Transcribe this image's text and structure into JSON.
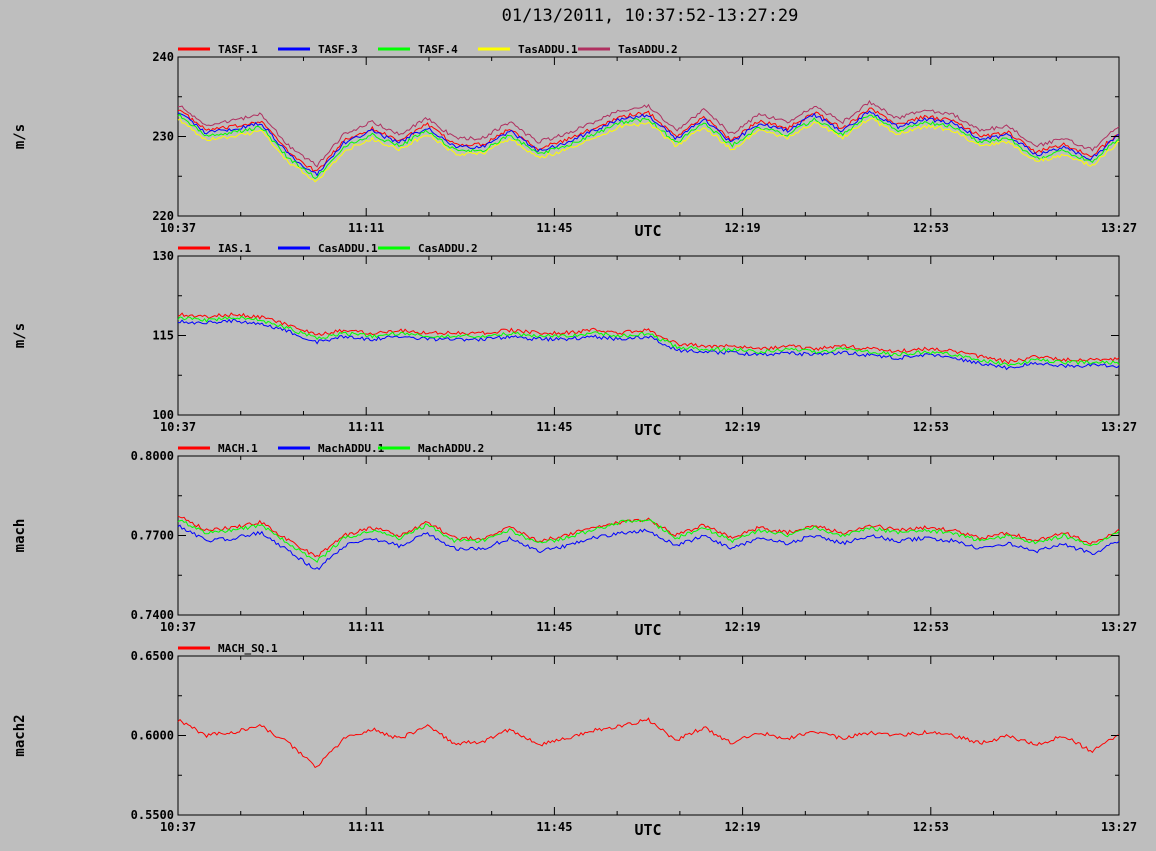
{
  "title": "01/13/2011, 10:37:52-13:27:29",
  "colors": {
    "background": "#bebebe",
    "red": "#ff0000",
    "blue": "#0000ff",
    "green": "#00ff00",
    "yellow": "#ffff00",
    "maroon": "#b03060"
  },
  "chart_data": [
    {
      "type": "line",
      "ylabel": "m/s",
      "xlabel": "UTC",
      "x_ticks": [
        "10:37",
        "11:11",
        "11:45",
        "12:19",
        "12:53",
        "13:27"
      ],
      "y_ticks": [
        "220",
        "230",
        "240"
      ],
      "ylim": [
        220,
        240
      ],
      "grid": false,
      "legend_position": "top-left",
      "series": [
        {
          "name": "TASF.1",
          "color": "#ff0000",
          "values": [
            233.5,
            230.8,
            231.2,
            232.0,
            228.0,
            225.5,
            229.5,
            231.0,
            229.5,
            231.5,
            229.0,
            229.0,
            231.0,
            228.5,
            229.5,
            231.0,
            232.5,
            233.0,
            230.0,
            232.5,
            229.5,
            232.0,
            231.0,
            233.0,
            231.0,
            233.5,
            231.5,
            232.5,
            232.0,
            230.0,
            230.5,
            228.0,
            229.0,
            227.5,
            230.5
          ]
        },
        {
          "name": "TASF.3",
          "color": "#0000ff",
          "values": [
            233.2,
            230.5,
            230.9,
            231.7,
            227.7,
            225.2,
            229.2,
            230.7,
            229.2,
            231.2,
            228.7,
            228.7,
            230.7,
            228.2,
            229.2,
            230.7,
            232.2,
            232.7,
            229.7,
            232.2,
            229.2,
            231.7,
            230.7,
            232.7,
            230.7,
            233.2,
            231.2,
            232.2,
            231.7,
            229.7,
            230.2,
            227.7,
            228.7,
            227.2,
            230.2
          ]
        },
        {
          "name": "TASF.4",
          "color": "#00ff00",
          "values": [
            232.8,
            230.0,
            230.5,
            231.2,
            227.2,
            224.8,
            228.7,
            230.2,
            228.8,
            230.8,
            228.3,
            228.2,
            230.2,
            227.8,
            228.8,
            230.2,
            231.8,
            232.2,
            229.2,
            231.8,
            228.8,
            231.2,
            230.2,
            232.2,
            230.2,
            232.8,
            230.7,
            231.8,
            231.2,
            229.2,
            229.8,
            227.2,
            228.2,
            226.8,
            229.8
          ]
        },
        {
          "name": "TasADDU.1",
          "color": "#ffff00",
          "values": [
            232.3,
            229.5,
            230.0,
            230.7,
            226.8,
            224.3,
            228.2,
            229.7,
            228.3,
            230.3,
            227.8,
            227.8,
            229.8,
            227.3,
            228.3,
            229.7,
            231.3,
            231.7,
            228.8,
            231.3,
            228.3,
            230.8,
            229.8,
            231.8,
            229.8,
            232.3,
            230.3,
            231.3,
            230.8,
            228.8,
            229.3,
            226.8,
            227.7,
            226.3,
            229.3
          ]
        },
        {
          "name": "TasADDU.2",
          "color": "#b03060",
          "values": [
            234.0,
            231.5,
            232.0,
            232.8,
            228.8,
            226.3,
            230.3,
            231.8,
            230.3,
            232.3,
            229.8,
            229.8,
            231.8,
            229.3,
            230.3,
            231.8,
            233.3,
            233.8,
            230.8,
            233.3,
            230.3,
            232.8,
            231.8,
            233.8,
            231.8,
            234.3,
            232.3,
            233.3,
            232.8,
            230.8,
            231.3,
            228.8,
            229.8,
            228.3,
            231.3
          ]
        }
      ]
    },
    {
      "type": "line",
      "ylabel": "m/s",
      "xlabel": "UTC",
      "x_ticks": [
        "10:37",
        "11:11",
        "11:45",
        "12:19",
        "12:53",
        "13:27"
      ],
      "y_ticks": [
        "100",
        "115",
        "130"
      ],
      "ylim": [
        100,
        130
      ],
      "grid": false,
      "legend_position": "top-left",
      "series": [
        {
          "name": "IAS.1",
          "color": "#ff0000",
          "values": [
            119.0,
            118.5,
            119.0,
            118.5,
            117.0,
            115.0,
            116.0,
            115.5,
            116.0,
            115.5,
            115.5,
            115.5,
            116.0,
            115.5,
            115.5,
            116.0,
            115.5,
            116.0,
            113.5,
            113.0,
            113.0,
            112.5,
            113.0,
            112.5,
            113.0,
            112.5,
            112.0,
            112.5,
            112.0,
            111.0,
            110.0,
            111.0,
            110.5,
            110.5,
            110.5
          ]
        },
        {
          "name": "CasADDU.1",
          "color": "#0000ff",
          "values": [
            117.8,
            117.3,
            117.8,
            117.3,
            115.8,
            113.8,
            114.8,
            114.3,
            114.8,
            114.3,
            114.3,
            114.3,
            114.8,
            114.3,
            114.3,
            114.8,
            114.3,
            114.8,
            112.3,
            111.8,
            111.8,
            111.3,
            111.8,
            111.3,
            111.8,
            111.3,
            110.8,
            111.3,
            110.8,
            109.8,
            108.8,
            109.8,
            109.3,
            109.3,
            109.3
          ]
        },
        {
          "name": "CasADDU.2",
          "color": "#00ff00",
          "values": [
            118.4,
            117.9,
            118.4,
            117.9,
            116.4,
            114.4,
            115.4,
            114.9,
            115.4,
            114.9,
            114.9,
            114.9,
            115.4,
            114.9,
            114.9,
            115.4,
            114.9,
            115.4,
            112.9,
            112.4,
            112.4,
            111.9,
            112.4,
            111.9,
            112.4,
            111.9,
            111.4,
            111.9,
            111.4,
            110.4,
            109.4,
            110.4,
            109.9,
            109.9,
            109.9
          ]
        }
      ]
    },
    {
      "type": "line",
      "ylabel": "mach",
      "xlabel": "UTC",
      "x_ticks": [
        "10:37",
        "11:11",
        "11:45",
        "12:19",
        "12:53",
        "13:27"
      ],
      "y_ticks": [
        "0.7400",
        "0.7700",
        "0.8000"
      ],
      "ylim": [
        0.74,
        0.8
      ],
      "grid": false,
      "legend_position": "top-left",
      "series": [
        {
          "name": "MACH.1",
          "color": "#ff0000",
          "values": [
            0.778,
            0.772,
            0.773,
            0.775,
            0.768,
            0.762,
            0.77,
            0.773,
            0.77,
            0.775,
            0.769,
            0.769,
            0.773,
            0.768,
            0.77,
            0.773,
            0.775,
            0.776,
            0.77,
            0.774,
            0.769,
            0.773,
            0.771,
            0.774,
            0.771,
            0.774,
            0.772,
            0.773,
            0.772,
            0.769,
            0.771,
            0.768,
            0.771,
            0.767,
            0.772
          ]
        },
        {
          "name": "MachADDU.1",
          "color": "#0000ff",
          "values": [
            0.774,
            0.768,
            0.769,
            0.771,
            0.764,
            0.757,
            0.766,
            0.769,
            0.766,
            0.771,
            0.765,
            0.765,
            0.769,
            0.764,
            0.766,
            0.769,
            0.771,
            0.772,
            0.766,
            0.77,
            0.765,
            0.769,
            0.767,
            0.77,
            0.767,
            0.77,
            0.768,
            0.769,
            0.768,
            0.765,
            0.767,
            0.764,
            0.767,
            0.763,
            0.768
          ]
        },
        {
          "name": "MachADDU.2",
          "color": "#00ff00",
          "values": [
            0.776,
            0.771,
            0.772,
            0.774,
            0.767,
            0.76,
            0.769,
            0.772,
            0.769,
            0.774,
            0.768,
            0.768,
            0.772,
            0.767,
            0.769,
            0.772,
            0.775,
            0.776,
            0.769,
            0.773,
            0.768,
            0.772,
            0.77,
            0.773,
            0.77,
            0.773,
            0.771,
            0.772,
            0.771,
            0.768,
            0.77,
            0.767,
            0.77,
            0.766,
            0.771
          ]
        }
      ]
    },
    {
      "type": "line",
      "ylabel": "mach2",
      "xlabel": "UTC",
      "x_ticks": [
        "10:37",
        "11:11",
        "11:45",
        "12:19",
        "12:53",
        "13:27"
      ],
      "y_ticks": [
        "0.5500",
        "0.6000",
        "0.6500"
      ],
      "ylim": [
        0.55,
        0.65
      ],
      "grid": false,
      "legend_position": "top-left",
      "series": [
        {
          "name": "MACH_SQ.1",
          "color": "#ff0000",
          "values": [
            0.61,
            0.6,
            0.602,
            0.606,
            0.595,
            0.58,
            0.598,
            0.604,
            0.598,
            0.606,
            0.595,
            0.596,
            0.604,
            0.594,
            0.598,
            0.603,
            0.606,
            0.61,
            0.597,
            0.605,
            0.595,
            0.602,
            0.598,
            0.603,
            0.598,
            0.602,
            0.6,
            0.602,
            0.6,
            0.595,
            0.6,
            0.594,
            0.6,
            0.59,
            0.6
          ]
        }
      ]
    }
  ]
}
